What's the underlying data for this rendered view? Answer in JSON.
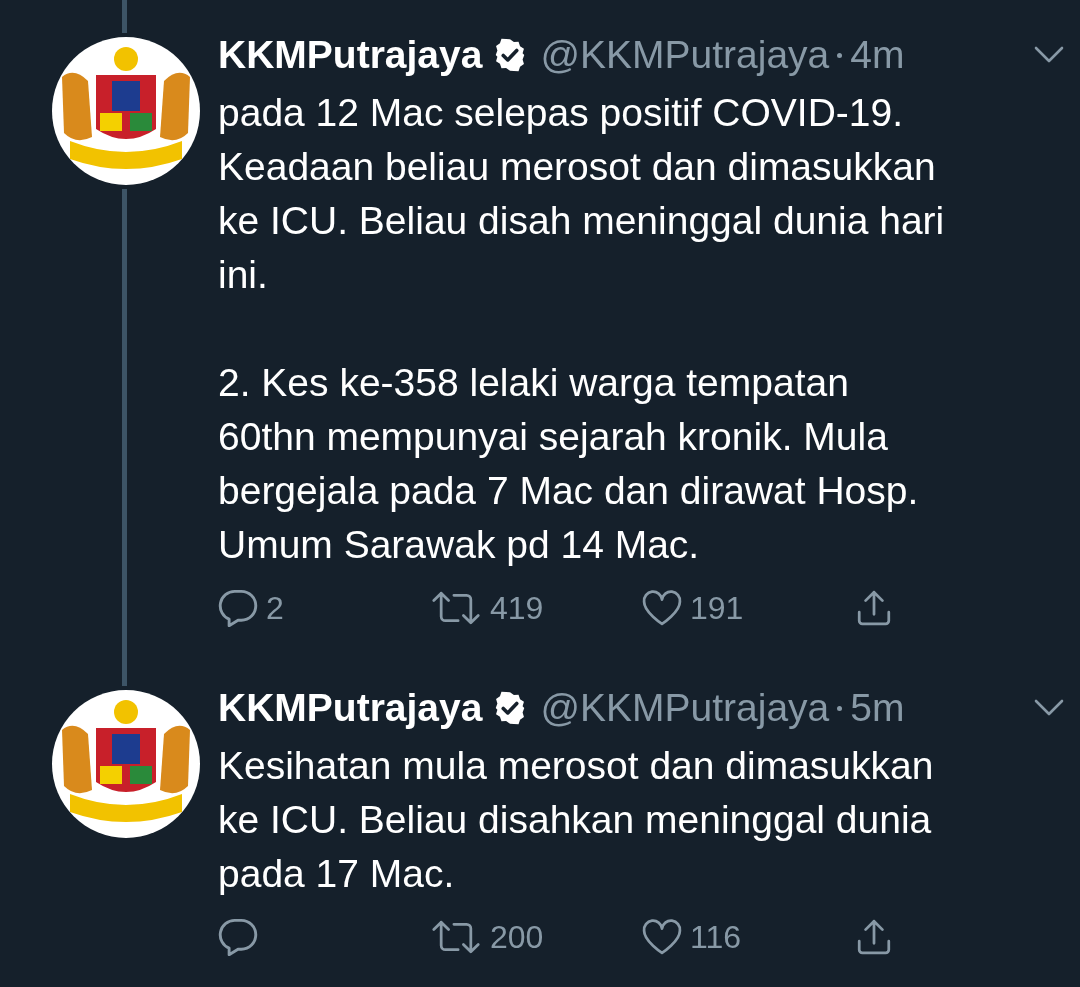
{
  "tweets": [
    {
      "name": "KKMPutrajaya",
      "verified": true,
      "handle": "@KKMPutrajaya",
      "time": "4m",
      "thread_line_above": true,
      "thread_line_below": true,
      "text": "pada 12 Mac selepas positif COVID-19.\nKeadaan beliau merosot dan dimasukkan\nke ICU. Beliau disah meninggal dunia hari\nini.\n\n2. Kes ke-358 lelaki warga tempatan\n60thn mempunyai sejarah kronik. Mula\nbergejala pada 7 Mac dan dirawat Hosp.\nUmum Sarawak pd 14 Mac.",
      "replies": "2",
      "retweets": "419",
      "likes": "191"
    },
    {
      "name": "KKMPutrajaya",
      "verified": true,
      "handle": "@KKMPutrajaya",
      "time": "5m",
      "thread_line_above": true,
      "thread_line_below": false,
      "text": "Kesihatan mula merosot dan dimasukkan\nke ICU. Beliau disahkan meninggal dunia\npada 17 Mac.",
      "retweets": "200",
      "likes": "116"
    }
  ]
}
